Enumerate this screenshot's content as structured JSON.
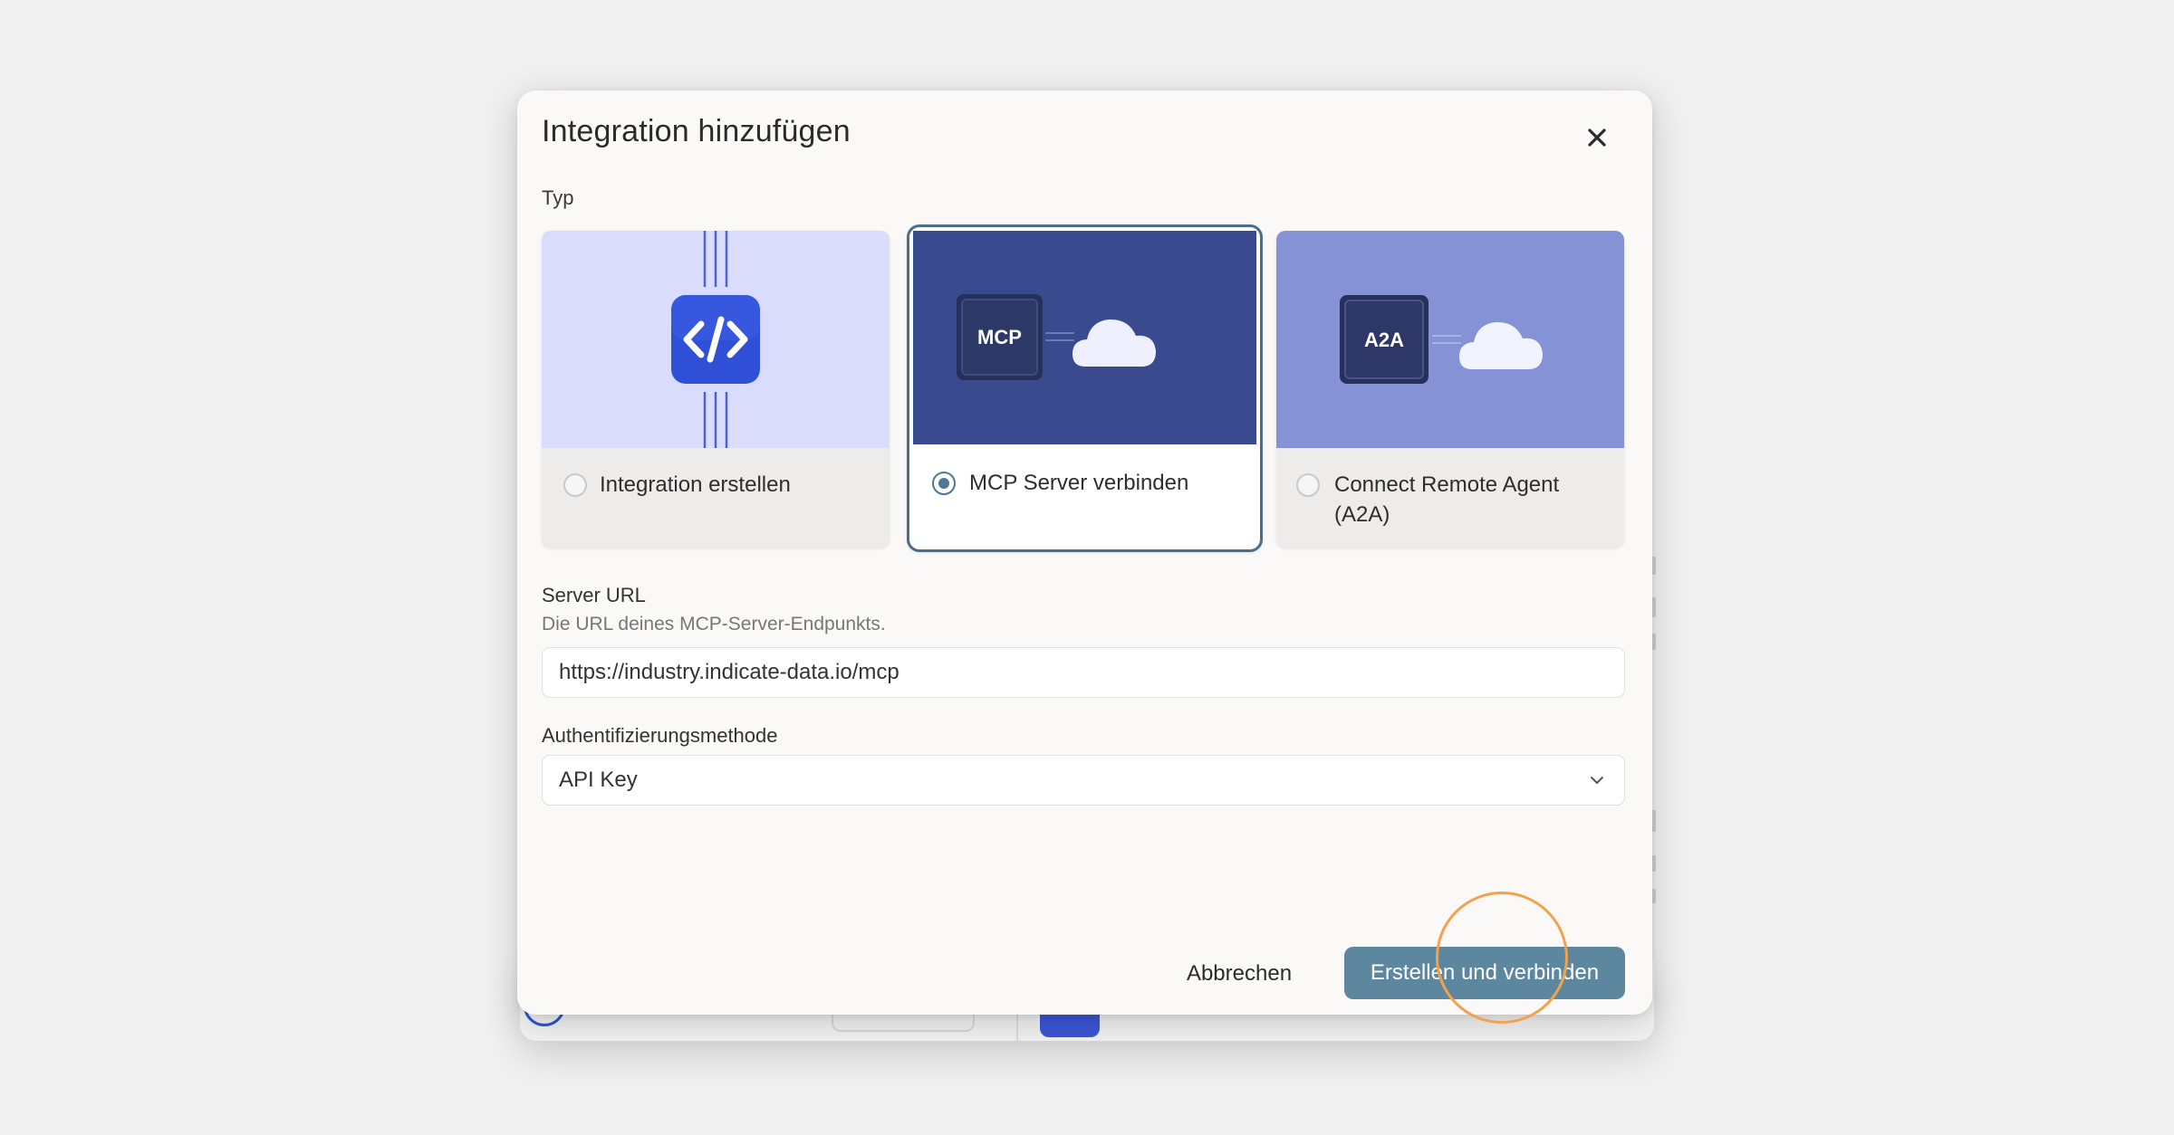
{
  "dialog": {
    "title": "Integration hinzufügen",
    "close_icon": "close-icon"
  },
  "type_section": {
    "label": "Typ",
    "options": [
      {
        "label": "Integration erstellen",
        "selected": false,
        "icon": "code-brackets-icon",
        "bg": "#d8dcfb"
      },
      {
        "label": "MCP Server verbinden",
        "selected": true,
        "chip": "MCP",
        "icon": "cloud-icon",
        "bg": "#3a4a8f"
      },
      {
        "label": "Connect Remote Agent (A2A)",
        "selected": false,
        "chip": "A2A",
        "icon": "cloud-icon",
        "bg": "#8593d6"
      }
    ]
  },
  "server_url": {
    "label": "Server URL",
    "help": "Die URL deines MCP-Server-Endpunkts.",
    "value": "https://industry.indicate-data.io/mcp"
  },
  "auth_method": {
    "label": "Authentifizierungsmethode",
    "selected": "API Key"
  },
  "footer": {
    "cancel_label": "Abbrechen",
    "submit_label": "Erstellen und verbinden"
  },
  "colors": {
    "accent": "#5d879f",
    "selected_border": "#4a6f8b",
    "highlight_ring": "#f2a24c"
  }
}
